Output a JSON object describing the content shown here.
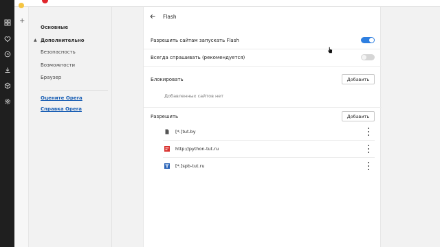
{
  "sidebar": {
    "icons": [
      "speed-dial-icon",
      "heart-icon",
      "history-icon",
      "downloads-icon",
      "extensions-icon",
      "settings-icon"
    ]
  },
  "nav": {
    "basic": "Основные",
    "advanced": "Дополнительно",
    "security": "Безопасность",
    "features": "Возможности",
    "browser": "Браузер",
    "rate": "Оцените Opera",
    "help": "Справка Opera"
  },
  "page": {
    "title": "Flash"
  },
  "settings": {
    "allow_flash": {
      "label": "Разрешить сайтам запускать Flash",
      "on": true
    },
    "always_ask": {
      "label": "Всегда спрашивать (рекомендуется)",
      "on": false
    }
  },
  "block": {
    "title": "Блокировать",
    "add_label": "Добавить",
    "empty": "Добавленных сайтов нет"
  },
  "allow": {
    "title": "Разрешить",
    "add_label": "Добавить",
    "sites": [
      {
        "name": "[*.]tut.by",
        "icon": "file-icon"
      },
      {
        "name": "http://python-tut.ru",
        "icon": "python-tut-favicon-icon"
      },
      {
        "name": "[*.]spb-tut.ru",
        "icon": "spb-tut-favicon-icon"
      }
    ]
  },
  "colors": {
    "accent": "#2f7fe0",
    "link": "#1a5fb4",
    "sidebar": "#1f1f1f",
    "opera_red": "#e0252b"
  }
}
